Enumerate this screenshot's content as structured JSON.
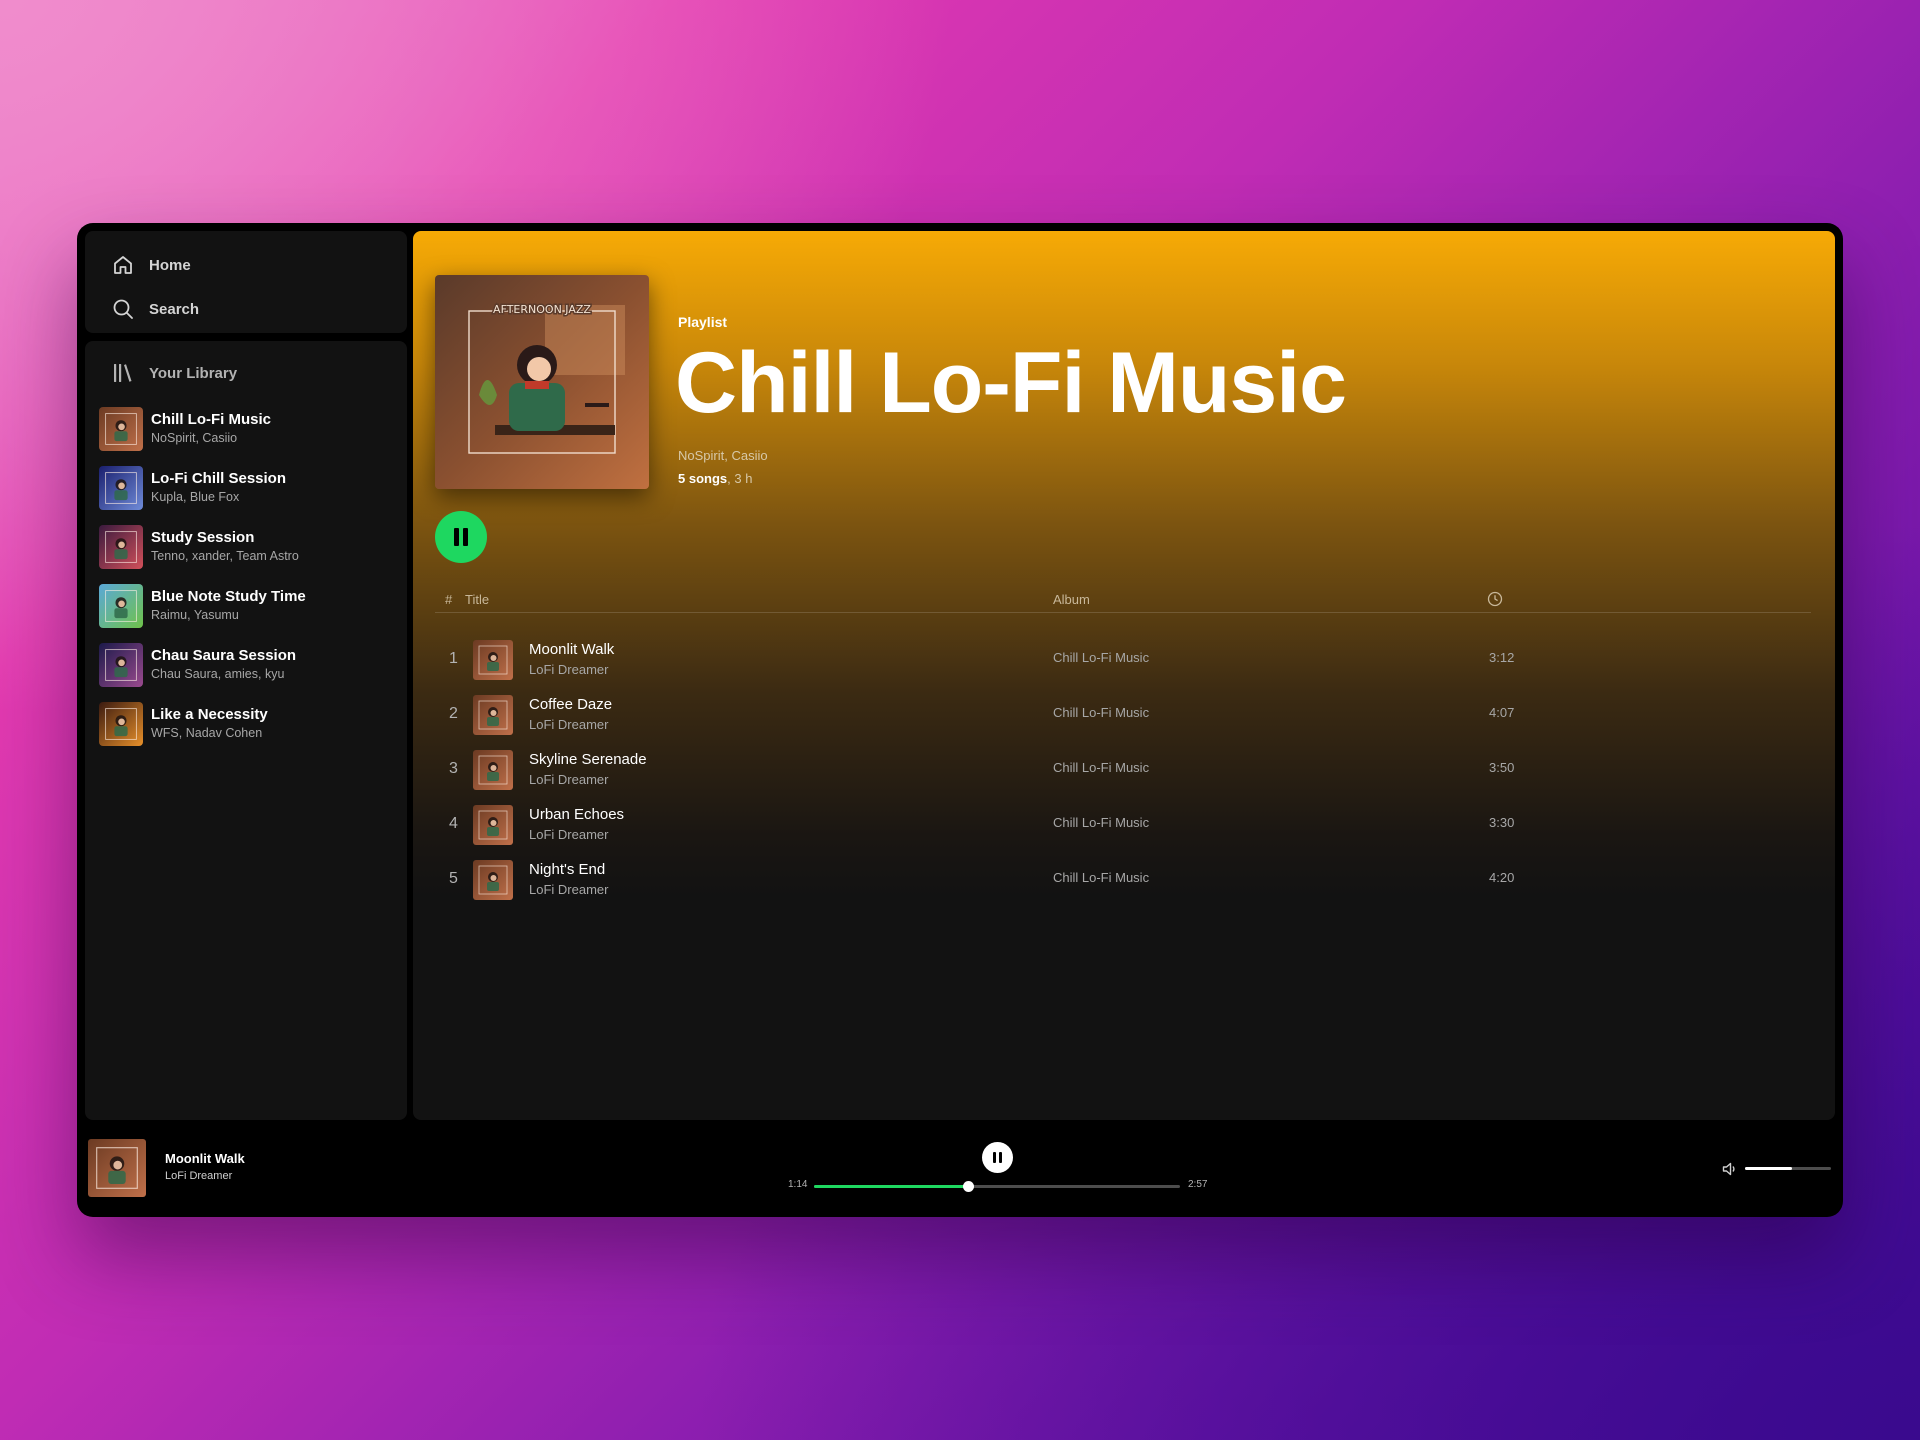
{
  "nav": {
    "home_label": "Home",
    "search_label": "Search"
  },
  "library": {
    "header": "Your Library",
    "items": [
      {
        "title": "Chill Lo-Fi Music",
        "subtitle": "NoSpirit, Casiio",
        "thumb_colors": [
          "#6b3a22",
          "#c0704a"
        ]
      },
      {
        "title": "Lo-Fi Chill Session",
        "subtitle": "Kupla, Blue Fox",
        "thumb_colors": [
          "#1a1f6e",
          "#6f8bd8"
        ]
      },
      {
        "title": "Study Session",
        "subtitle": "Tenno, xander, Team Astro",
        "thumb_colors": [
          "#3a1a3e",
          "#d2505a"
        ]
      },
      {
        "title": "Blue Note Study Time",
        "subtitle": "Raimu, Yasumu",
        "thumb_colors": [
          "#5aa8d8",
          "#6fc24a"
        ]
      },
      {
        "title": "Chau Saura Session",
        "subtitle": "Chau Saura, amies, kyu",
        "thumb_colors": [
          "#1c1a4a",
          "#9a4a8e"
        ]
      },
      {
        "title": "Like a Necessity",
        "subtitle": "WFS, Nadav Cohen",
        "thumb_colors": [
          "#3a1a10",
          "#e8902a"
        ]
      }
    ]
  },
  "playlist": {
    "type_label": "Playlist",
    "title": "Chill Lo-Fi Music",
    "artists": "NoSpirit, Casiio",
    "song_count": "5 songs",
    "duration": ", 3 h",
    "cover_text": "AFTERNOON JAZZ",
    "gradient_color": "#f7aa05"
  },
  "track_table": {
    "col_number": "#",
    "col_title": "Title",
    "col_album": "Album",
    "col_duration_icon": "clock-icon",
    "tracks": [
      {
        "number": "1",
        "title": "Moonlit Walk",
        "artist": "LoFi Dreamer",
        "album": "Chill Lo-Fi Music",
        "duration": "3:12"
      },
      {
        "number": "2",
        "title": "Coffee Daze",
        "artist": "LoFi Dreamer",
        "album": "Chill Lo-Fi Music",
        "duration": "4:07"
      },
      {
        "number": "3",
        "title": "Skyline Serenade",
        "artist": "LoFi Dreamer",
        "album": "Chill Lo-Fi Music",
        "duration": "3:50"
      },
      {
        "number": "4",
        "title": "Urban Echoes",
        "artist": "LoFi Dreamer",
        "album": "Chill Lo-Fi Music",
        "duration": "3:30"
      },
      {
        "number": "5",
        "title": "Night's End",
        "artist": "LoFi Dreamer",
        "album": "Chill Lo-Fi Music",
        "duration": "4:20"
      }
    ]
  },
  "player": {
    "now_playing_title": "Moonlit Walk",
    "now_playing_artist": "LoFi Dreamer",
    "elapsed": "1:14",
    "total": "2:57",
    "progress_fraction": 0.42,
    "volume_fraction": 0.55,
    "accent_color": "#1ed760"
  }
}
